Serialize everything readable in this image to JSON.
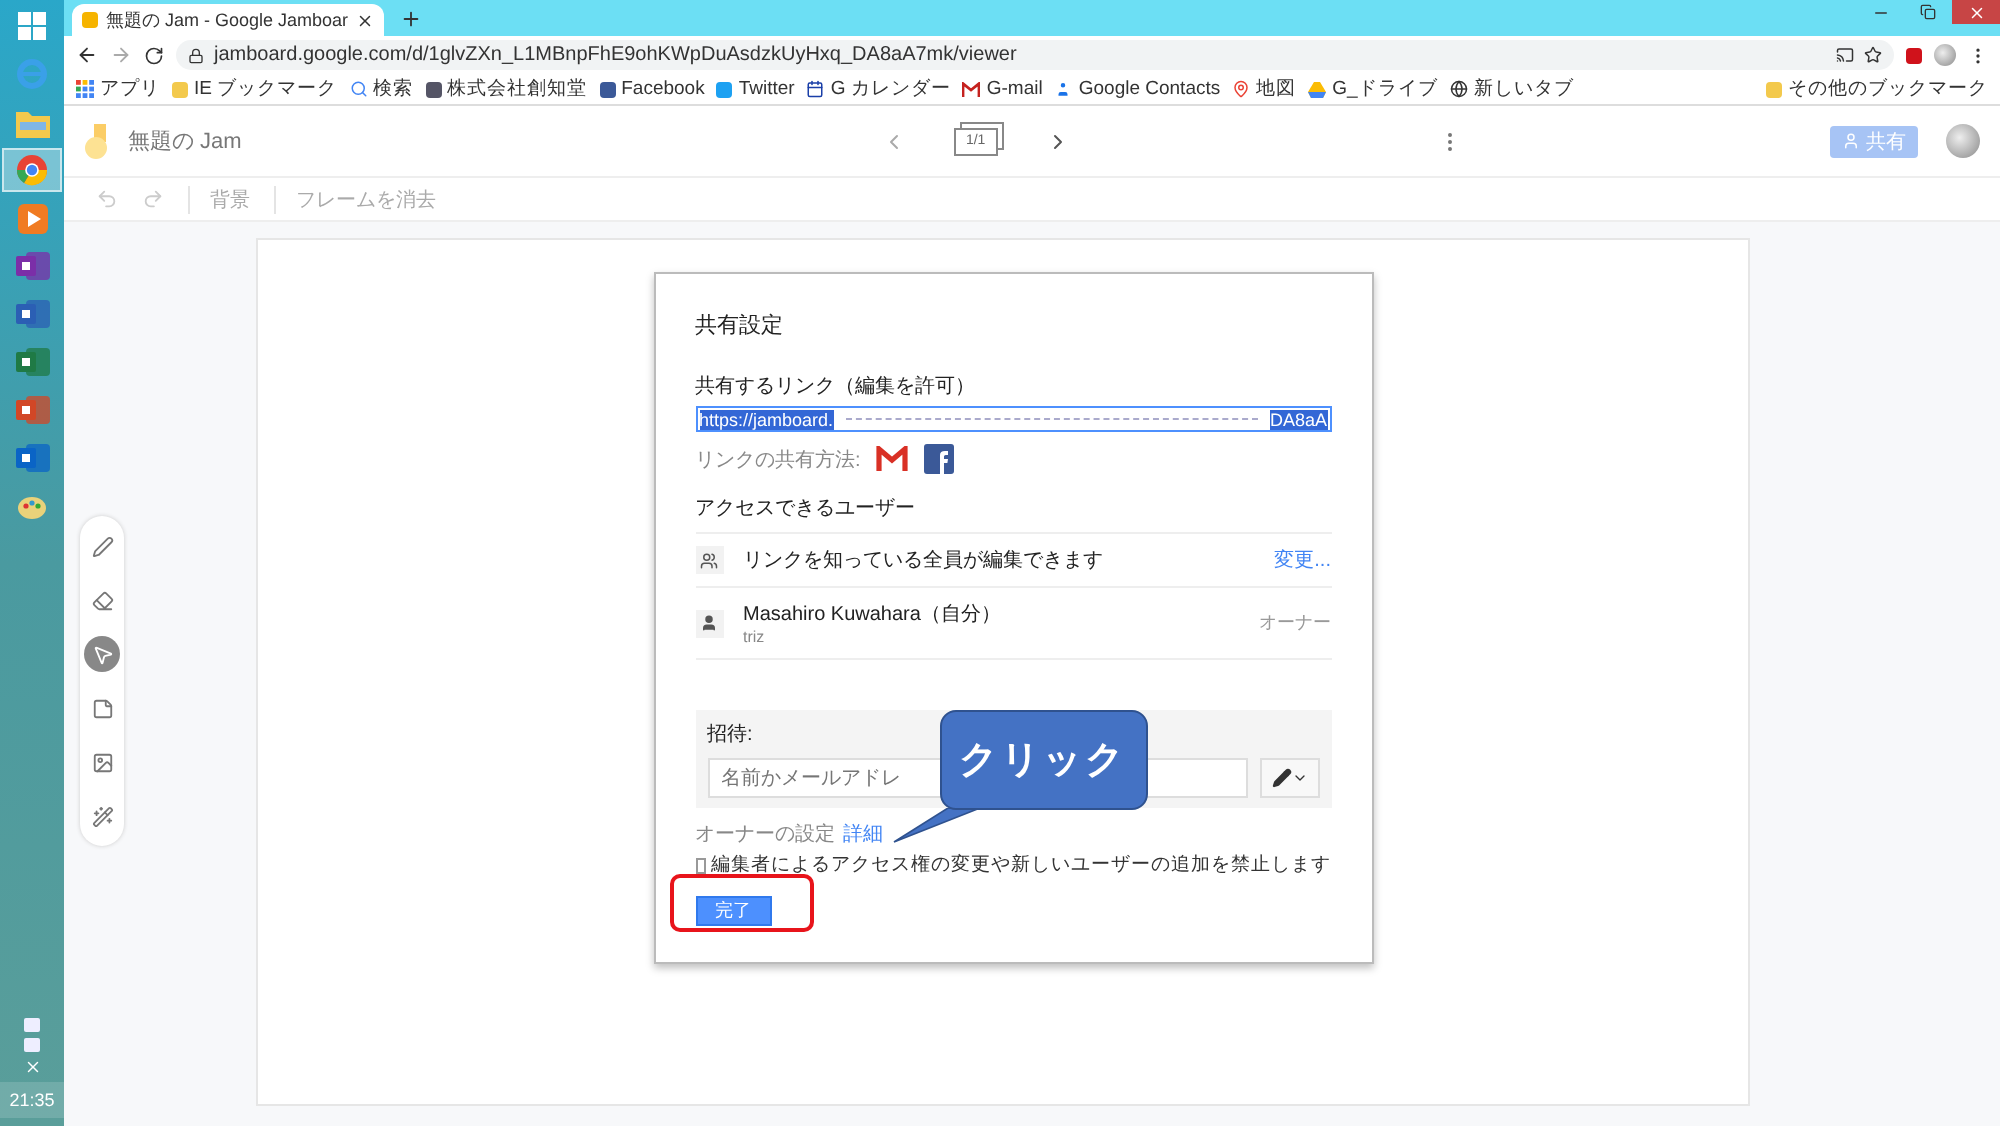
{
  "taskbar": {
    "apps": [
      {
        "kind": "windows",
        "selected": false
      },
      {
        "kind": "ie",
        "selected": false
      },
      {
        "kind": "folder",
        "selected": false
      },
      {
        "kind": "chrome",
        "selected": true
      },
      {
        "kind": "media",
        "selected": false
      },
      {
        "kind": "onenote",
        "selected": false
      },
      {
        "kind": "word",
        "selected": false
      },
      {
        "kind": "excel",
        "selected": false
      },
      {
        "kind": "powerpoint",
        "selected": false
      },
      {
        "kind": "outlook",
        "selected": false
      },
      {
        "kind": "paint",
        "selected": false
      }
    ],
    "clock": "21:35"
  },
  "browser": {
    "tab": {
      "title": "無題の Jam - Google Jamboar"
    },
    "address": "jamboard.google.com/d/1glvZXn_L1MBnpFhE9ohKWpDuAsdzkUyHxq_DA8aA7mk/viewer",
    "bookmarks": [
      {
        "kind": "apps",
        "label": "アプリ"
      },
      {
        "kind": "folder",
        "label": "IE ブックマーク"
      },
      {
        "kind": "google",
        "label": "検索"
      },
      {
        "kind": "site",
        "label": "株式会社創知堂"
      },
      {
        "kind": "facebook",
        "label": "Facebook"
      },
      {
        "kind": "twitter",
        "label": "Twitter"
      },
      {
        "kind": "calendar",
        "label": "G カレンダー"
      },
      {
        "kind": "gmail",
        "label": "G-mail"
      },
      {
        "kind": "contacts",
        "label": "Google Contacts"
      },
      {
        "kind": "maps",
        "label": "地図"
      },
      {
        "kind": "drive",
        "label": "G_ドライブ"
      },
      {
        "kind": "globe",
        "label": "新しいタブ"
      }
    ],
    "other_bookmarks": "その他のブックマーク"
  },
  "app": {
    "title": "無題の Jam",
    "frame_counter": "1/1",
    "share_button": "共有",
    "toolbar": [
      {
        "label": "背景",
        "disabled": true
      },
      {
        "label": "フレームを消去",
        "disabled": true
      }
    ],
    "tools": [
      {
        "kind": "pen",
        "selected": false
      },
      {
        "kind": "eraser",
        "selected": false
      },
      {
        "kind": "select",
        "selected": true
      },
      {
        "kind": "note",
        "selected": false
      },
      {
        "kind": "image",
        "selected": false
      },
      {
        "kind": "laser",
        "selected": false
      }
    ]
  },
  "dialog": {
    "title": "共有設定",
    "link_label": "共有するリンク（編集を許可）",
    "link_start": "https://jamboard.",
    "link_end": "DA8aA",
    "share_via": "リンクの共有方法:",
    "access_heading": "アクセスできるユーザー",
    "people": [
      {
        "kind": "link",
        "name": "リンクを知っている全員が編集できます",
        "action": "変更..."
      },
      {
        "kind": "user",
        "name": "Masahiro Kuwahara（自分）",
        "sub": "triz",
        "role": "オーナー"
      }
    ],
    "invite_label": "招待:",
    "invite_placeholder": "名前かメールアドレ",
    "owner_settings": "オーナーの設定",
    "details_link": "詳細",
    "restrict": {
      "label": "編集者によるアクセス権の変更や新しいユーザーの追加を禁止します",
      "checked": false
    },
    "done_button": "完了"
  },
  "callout": {
    "text": "クリック"
  }
}
